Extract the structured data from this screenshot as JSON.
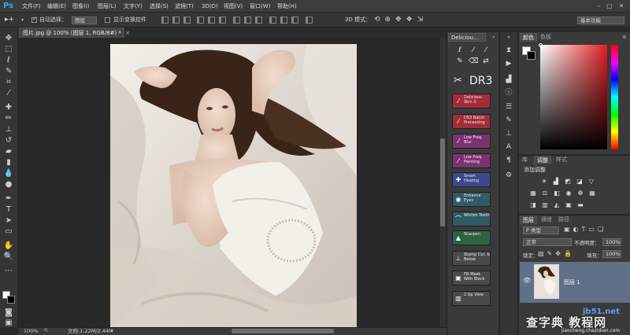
{
  "app": {
    "logo": "Ps"
  },
  "menu": [
    "文件(F)",
    "编辑(E)",
    "图像(I)",
    "图层(L)",
    "文字(Y)",
    "选择(S)",
    "滤镜(T)",
    "3D(D)",
    "视图(V)",
    "窗口(W)",
    "帮助(H)"
  ],
  "window_controls": [
    "–",
    "□",
    "✕"
  ],
  "options": {
    "auto_select_label": "自动选择：",
    "auto_select_value": "图层",
    "transform_label": "显示变换控件",
    "mode_3d_label": "3D 模式：",
    "workspace": "基本功能"
  },
  "document": {
    "tab_title": "图片.jpg @ 100% (图层 1, RGB/8#) *",
    "zoom": "100%",
    "doc_size": "文档:1.22M/2.44M"
  },
  "delicious": {
    "tab_label": "Deliciou…",
    "brand": "DR3",
    "actions": [
      {
        "label": "Delicious Skin 3",
        "color": "#a32c3a",
        "icon": "brush-icon"
      },
      {
        "label": "DS3 Batch Processing",
        "color": "#a32c3a",
        "icon": "brush-icon"
      },
      {
        "label": "Low Freq. Blur",
        "color": "#7d3270",
        "icon": "brush-icon"
      },
      {
        "label": "Low Freq. Painting",
        "color": "#7d3270",
        "icon": "brush-icon"
      },
      {
        "label": "Smart Healing",
        "color": "#3b4a8c",
        "icon": "bandage-icon"
      },
      {
        "label": "Enhance Eyes",
        "color": "#2f5a66",
        "icon": "eye-icon"
      },
      {
        "label": "Whiten Teeth",
        "color": "#2f5a66",
        "icon": "tooth-icon"
      },
      {
        "label": "Sharpen",
        "color": "#2e6340",
        "icon": "triangle-icon"
      },
      {
        "label": "Stamp Cur. & Below",
        "color": "#4a4a4a",
        "icon": "stamp-icon"
      },
      {
        "label": "Fill Mask With Black",
        "color": "#4a4a4a",
        "icon": "mask-icon"
      },
      {
        "label": "2 Up View",
        "color": "#4a4a4a",
        "icon": "view-icon"
      }
    ]
  },
  "color_panel": {
    "tabs": [
      "颜色",
      "色板"
    ],
    "fg": "#ffffff",
    "bg": "#000000",
    "hue_color": "#e21f24"
  },
  "adjust_panel": {
    "tabs": [
      "库",
      "调整",
      "样式"
    ],
    "title": "添加调整"
  },
  "layers_panel": {
    "tabs": [
      "图层",
      "通道",
      "路径"
    ],
    "filter": "P 类型",
    "blend_mode": "正常",
    "opacity_label": "不透明度：",
    "opacity_value": "100%",
    "lock_label": "锁定：",
    "fill_label": "填充：",
    "fill_value": "100%",
    "layer_name": "图层 1"
  },
  "watermark": {
    "site": "jb51.net",
    "brand": "查字典 教程网",
    "url": "jiaocheng.chazidian.com"
  }
}
